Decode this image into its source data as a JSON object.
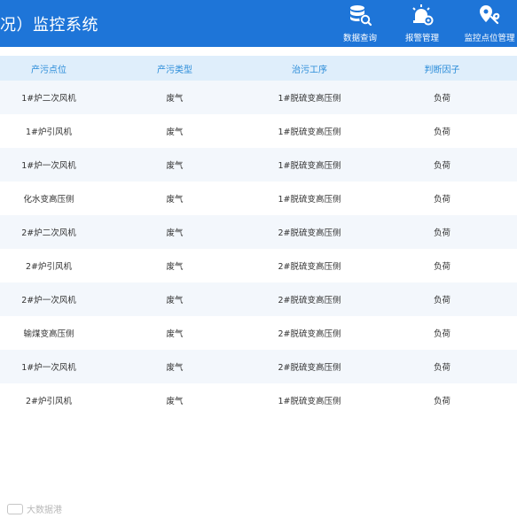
{
  "header": {
    "title": "况）监控系统",
    "nav": [
      {
        "label": "数据查询",
        "icon": "database-search-icon"
      },
      {
        "label": "报警管理",
        "icon": "alarm-gear-icon"
      },
      {
        "label": "监控点位管理",
        "icon": "location-wrench-icon"
      }
    ]
  },
  "table": {
    "columns": [
      "产污点位",
      "产污类型",
      "治污工序",
      "判断因子"
    ],
    "rows": [
      [
        "1#炉二次风机",
        "废气",
        "1#脱硫变高压侧",
        "负荷"
      ],
      [
        "1#炉引风机",
        "废气",
        "1#脱硫变高压侧",
        "负荷"
      ],
      [
        "1#炉一次风机",
        "废气",
        "1#脱硫变高压侧",
        "负荷"
      ],
      [
        "化水变高压侧",
        "废气",
        "1#脱硫变高压侧",
        "负荷"
      ],
      [
        "2#炉二次风机",
        "废气",
        "2#脱硫变高压侧",
        "负荷"
      ],
      [
        "2#炉引风机",
        "废气",
        "2#脱硫变高压侧",
        "负荷"
      ],
      [
        "2#炉一次风机",
        "废气",
        "2#脱硫变高压侧",
        "负荷"
      ],
      [
        "输煤变高压侧",
        "废气",
        "2#脱硫变高压侧",
        "负荷"
      ],
      [
        "1#炉一次风机",
        "废气",
        "2#脱硫变高压侧",
        "负荷"
      ],
      [
        "2#炉引风机",
        "废气",
        "1#脱硫变高压侧",
        "负荷"
      ]
    ]
  },
  "watermark": {
    "text": "大数据港"
  }
}
